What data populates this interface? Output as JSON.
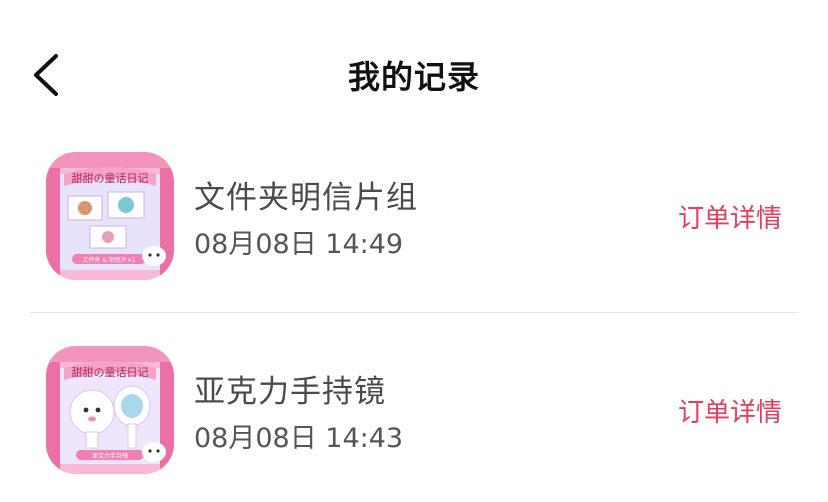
{
  "header": {
    "back_icon": "chevron-left-icon",
    "title": "我的记录"
  },
  "records": [
    {
      "title": "文件夹明信片组",
      "time": "08月08日 14:49",
      "action_label": "订单详情",
      "thumbnail_banner": "甜甜の童话日记",
      "thumbnail_caption": "文件夹 & 明信片×2"
    },
    {
      "title": "亚克力手持镜",
      "time": "08月08日 14:43",
      "action_label": "订单详情",
      "thumbnail_banner": "甜甜の童话日记",
      "thumbnail_caption": "亚克力手持镜"
    }
  ],
  "colors": {
    "accent": "#e53d5c",
    "title_text": "#111111",
    "item_text": "#4a4a4a",
    "divider": "#e2e2e2"
  }
}
